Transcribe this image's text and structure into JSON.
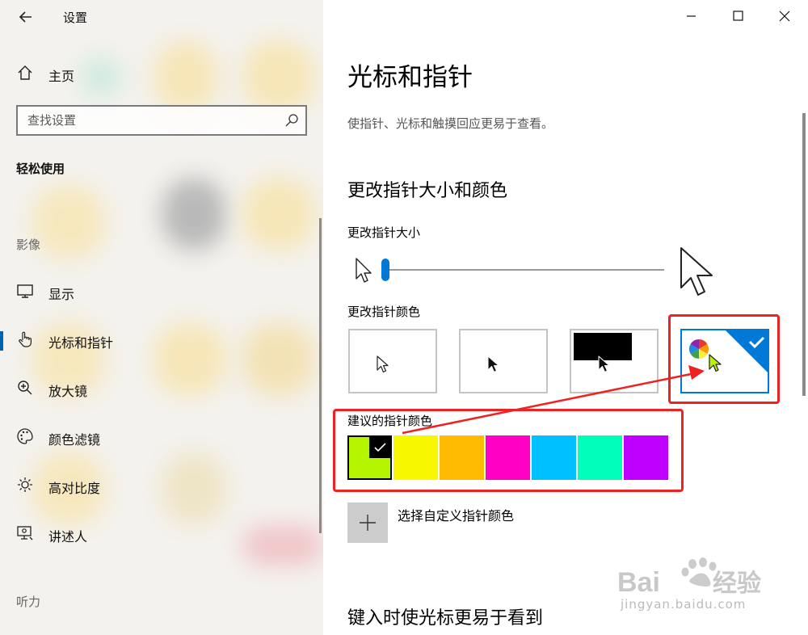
{
  "window": {
    "app_title": "设置",
    "back_icon": "arrow-left-icon"
  },
  "sidebar": {
    "home_label": "主页",
    "search_placeholder": "查找设置",
    "category_title": "轻松使用",
    "group_vision": "影像",
    "items": [
      {
        "label": "显示",
        "icon": "monitor-icon"
      },
      {
        "label": "光标和指针",
        "icon": "pointer-hand-icon",
        "active": true
      },
      {
        "label": "放大镜",
        "icon": "magnifier-plus-icon"
      },
      {
        "label": "颜色滤镜",
        "icon": "palette-icon"
      },
      {
        "label": "高对比度",
        "icon": "sun-icon"
      },
      {
        "label": "讲述人",
        "icon": "narrator-icon"
      }
    ],
    "group_hearing": "听力"
  },
  "main": {
    "page_title": "光标和指针",
    "page_desc": "使指针、光标和触摸回应更易于查看。",
    "section_size_color": "更改指针大小和颜色",
    "size_label": "更改指针大小",
    "size_level": 0.0,
    "color_label": "更改指针颜色",
    "color_options": [
      "white",
      "black",
      "inverted",
      "custom"
    ],
    "selected_color_option": 3,
    "suggested_label": "建议的指针颜色",
    "suggested_colors": [
      "#b5f500",
      "#f7f700",
      "#ffbb00",
      "#ff00c4",
      "#00c0ff",
      "#00ffbb",
      "#c000ff"
    ],
    "selected_suggested": 0,
    "custom_color_label": "选择自定义指针颜色",
    "section_typing": "键入时使光标更易于看到"
  },
  "colors": {
    "accent": "#0078d7",
    "annotation": "#ee2222"
  },
  "watermark": {
    "brand": "Bai du 经验",
    "url": "jingyan.baidu.com"
  }
}
